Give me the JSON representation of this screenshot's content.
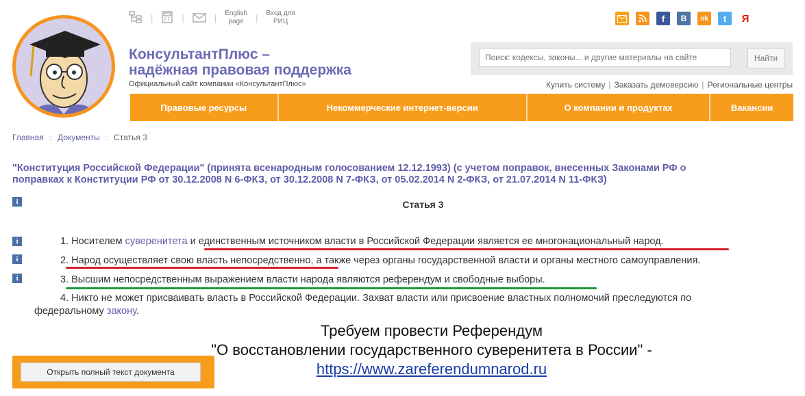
{
  "header": {
    "top_links": [
      {
        "icon": "sitemap-icon"
      },
      {
        "icon": "calculator-icon"
      },
      {
        "icon": "mail-icon"
      },
      {
        "label_line1": "English",
        "label_line2": "page"
      },
      {
        "label_line1": "Вход для",
        "label_line2": "РИЦ"
      }
    ],
    "brand_line1": "КонсультантПлюс –",
    "brand_line2": "надёжная правовая поддержка",
    "brand_sub": "Официальный сайт компании «КонсультантПлюс»",
    "socials": [
      {
        "icon": "email-subscribe-icon",
        "glyph": "✉",
        "color": "#f7a21b"
      },
      {
        "icon": "rss-icon",
        "glyph": "◉",
        "color": "#f7941d"
      },
      {
        "icon": "facebook-icon",
        "glyph": "f",
        "color": "#3b5998"
      },
      {
        "icon": "vkontakte-icon",
        "glyph": "B",
        "color": "#4c75a3"
      },
      {
        "icon": "odnoklassniki-icon",
        "glyph": "ok",
        "color": "#f7931e"
      },
      {
        "icon": "twitter-icon",
        "glyph": "t",
        "color": "#55acee"
      },
      {
        "icon": "yandex-icon",
        "glyph": "Я",
        "color": "#ffffff",
        "text_color": "#e61400"
      }
    ],
    "search_placeholder": "Поиск: кодексы, законы... и другие материалы на сайте",
    "search_button": "Найти",
    "links": [
      "Купить систему",
      "Заказать демоверсию",
      "Региональные центры"
    ]
  },
  "nav": [
    {
      "label": "Правовые ресурсы"
    },
    {
      "label": "Некоммерческие интернет-версии"
    },
    {
      "label": "О компании и продуктах"
    },
    {
      "label": "Вакансии"
    }
  ],
  "breadcrumb": [
    "Главная",
    "Документы",
    "Статья 3"
  ],
  "doc_title_line1": "\"Конституция Российской Федерации\" (принята всенародным голосованием 12.12.1993) (с учетом поправок, внесенных Законами РФ о",
  "doc_title_line2": "поправках к Конституции РФ от 30.12.2008 N 6-ФКЗ, от 30.12.2008 N 7-ФКЗ, от 05.02.2014 N 2-ФКЗ, от 21.07.2014 N 11-ФКЗ)",
  "info_glyph": "i",
  "article_heading": "Статья 3",
  "paragraphs": {
    "p1_a": "1. Носителем ",
    "p1_link": "суверенитета",
    "p1_b": " и ",
    "p1_c": "единственным источником власти в Российской Федерации является ее многонациональный народ.",
    "p2_a": "2. ",
    "p2_b": "Народ осуществляет свою власть непосредственно",
    "p2_c": ", а также через органы государственной власти и органы местного самоуправления.",
    "p3_a": "3. ",
    "p3_b": "Высшим непосредственным выражением власти народа являются референдум и свободные выборы.",
    "p4_a": "4. Никто не может присваивать власть в Российской Федерации. Захват власти или присвоение властных полномочий преследуются по",
    "p4_b": "федеральному ",
    "p4_link": "закону",
    "p4_c": "."
  },
  "open_full_text_button": "Открыть полный текст документа",
  "overlay": {
    "line1": "Требуем провести Референдум",
    "line2": "\"О восстановлении государственного суверенитета в России\" -",
    "url": "https://www.zareferendumnarod.ru"
  },
  "colors": {
    "accent_orange": "#f89c1c",
    "brand_purple": "#6b6bb5",
    "underline_red": "#d81e2a",
    "underline_green": "#1a9a3c"
  }
}
